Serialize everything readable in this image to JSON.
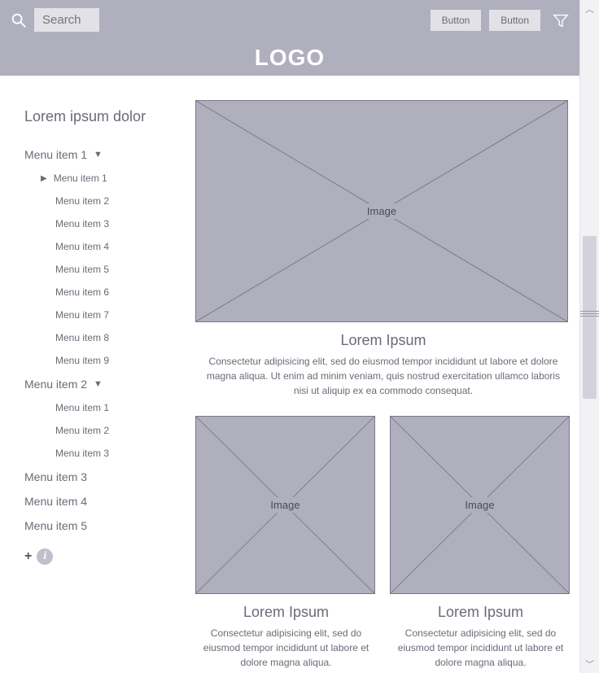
{
  "header": {
    "search_placeholder": "Search",
    "button1": "Button",
    "button2": "Button",
    "logo": "LOGO"
  },
  "sidebar": {
    "title": "Lorem ipsum dolor",
    "group1": {
      "label": "Menu item 1",
      "items": [
        "Menu item 1",
        "Menu item 2",
        "Menu item 3",
        "Menu item 4",
        "Menu item 5",
        "Menu item 6",
        "Menu item 7",
        "Menu item 8",
        "Menu item 9"
      ]
    },
    "group2": {
      "label": "Menu item 2",
      "items": [
        "Menu item 1",
        "Menu item 2",
        "Menu item 3"
      ]
    },
    "plain": [
      "Menu item 3",
      "Menu item 4",
      "Menu item 5"
    ]
  },
  "placeholder_label": "Image",
  "card_large": {
    "title": "Lorem Ipsum",
    "desc": "Consectetur adipisicing elit, sed do eiusmod tempor incididunt ut labore et dolore magna aliqua. Ut enim ad minim veniam, quis nostrud exercitation ullamco laboris nisi ut aliquip ex ea commodo consequat."
  },
  "card_small1": {
    "title": "Lorem Ipsum",
    "desc": "Consectetur adipisicing elit, sed do eiusmod tempor incididunt ut labore et dolore magna aliqua."
  },
  "card_small2": {
    "title": "Lorem Ipsum",
    "desc": "Consectetur adipisicing elit, sed do eiusmod tempor incididunt ut labore et dolore magna aliqua."
  }
}
